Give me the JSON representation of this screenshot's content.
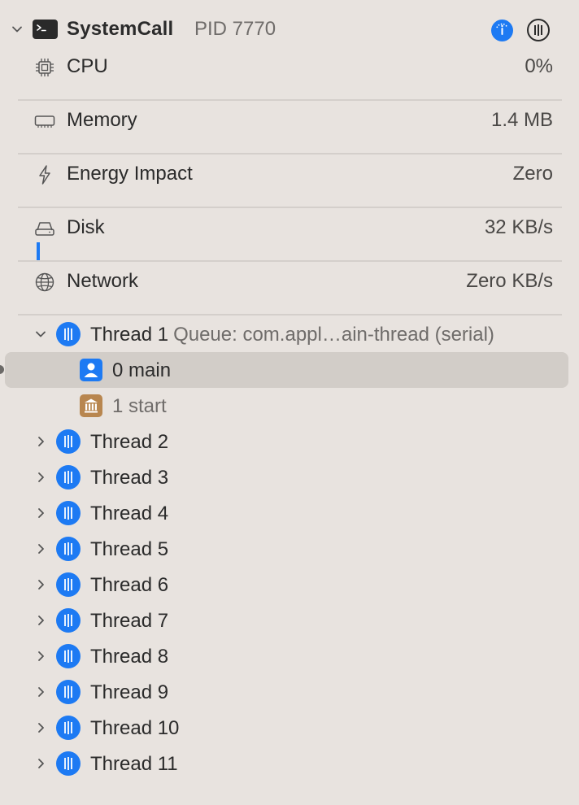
{
  "process": {
    "name": "SystemCall",
    "pid_label": "PID 7770",
    "icon": "terminal-icon"
  },
  "metrics": [
    {
      "icon": "cpu-chip-icon",
      "label": "CPU",
      "value": "0%"
    },
    {
      "icon": "memory-icon",
      "label": "Memory",
      "value": "1.4 MB"
    },
    {
      "icon": "bolt-icon",
      "label": "Energy Impact",
      "value": "Zero"
    },
    {
      "icon": "disk-icon",
      "label": "Disk",
      "value": "32 KB/s"
    },
    {
      "icon": "globe-icon",
      "label": "Network",
      "value": "Zero KB/s"
    }
  ],
  "threads": [
    {
      "label": "Thread 1",
      "queue": "Queue: com.appl…ain-thread (serial)",
      "expanded": true,
      "frames": [
        {
          "label": "0 main",
          "icon": "user-icon",
          "selected": true
        },
        {
          "label": "1 start",
          "icon": "library-icon",
          "selected": false
        }
      ]
    },
    {
      "label": "Thread 2"
    },
    {
      "label": "Thread 3"
    },
    {
      "label": "Thread 4"
    },
    {
      "label": "Thread 5"
    },
    {
      "label": "Thread 6"
    },
    {
      "label": "Thread 7"
    },
    {
      "label": "Thread 8"
    },
    {
      "label": "Thread 9"
    },
    {
      "label": "Thread 10"
    },
    {
      "label": "Thread 11"
    }
  ],
  "colors": {
    "accent": "#1d7af3",
    "background": "#e8e3df",
    "selection": "#d2cdc8",
    "library_icon": "#b8864f"
  }
}
